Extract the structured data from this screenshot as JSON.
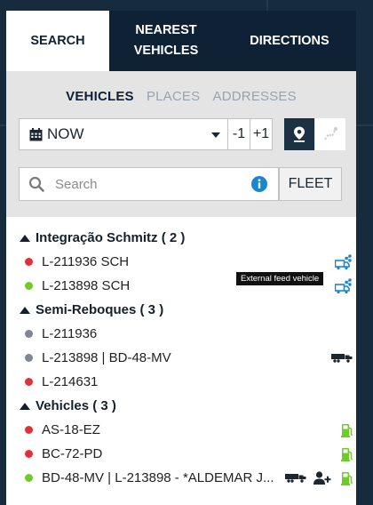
{
  "colors": {
    "offline": "#e0303a",
    "online": "#6fcc26",
    "unknown": "#7e8792",
    "accent": "#1a86d0",
    "fuel": "#6fcc26"
  },
  "tabs": [
    {
      "label": "SEARCH",
      "active": true
    },
    {
      "label": "NEAREST\nVEHICLES",
      "active": false
    },
    {
      "label": "DIRECTIONS",
      "active": false
    }
  ],
  "modes": [
    {
      "label": "VEHICLES",
      "active": true
    },
    {
      "label": "PLACES",
      "active": false
    },
    {
      "label": "ADDRESSES",
      "active": false
    }
  ],
  "time": {
    "value": "NOW",
    "minus": "-1",
    "plus": "+1"
  },
  "search": {
    "placeholder": "Search",
    "value": "",
    "fleet_label": "FLEET"
  },
  "groups": [
    {
      "name": "Integração Schmitz ( 2 )",
      "items": [
        {
          "label": "L-211936 SCH",
          "status": "offline",
          "icons": [
            "shared-truck-icon"
          ]
        },
        {
          "label": "L-213898 SCH",
          "status": "online",
          "icons": [
            "shared-truck-icon"
          ]
        }
      ]
    },
    {
      "name": "Semi-Reboques ( 3 )",
      "items": [
        {
          "label": "L-211936",
          "status": "unknown",
          "icons": []
        },
        {
          "label": "L-213898 | BD-48-MV",
          "status": "unknown",
          "icons": [
            "trailer-icon"
          ]
        },
        {
          "label": "L-214631",
          "status": "offline",
          "icons": []
        }
      ]
    },
    {
      "name": "Vehicles ( 3 )",
      "items": [
        {
          "label": "AS-18-EZ",
          "status": "offline",
          "icons": [
            "fuel-pump-icon"
          ]
        },
        {
          "label": "BC-72-PD",
          "status": "offline",
          "icons": [
            "fuel-pump-icon"
          ]
        },
        {
          "label": "BD-48-MV | L-213898 - *ALDEMAR J...",
          "status": "online",
          "icons": [
            "trailer-icon",
            "add-driver-icon",
            "fuel-pump-icon"
          ]
        }
      ]
    }
  ],
  "tooltip": "External feed vehicle"
}
